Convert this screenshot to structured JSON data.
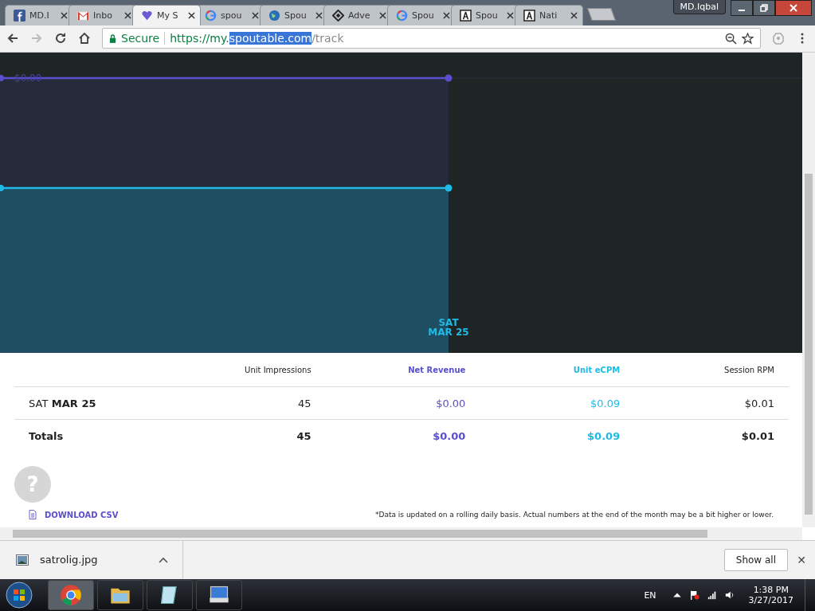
{
  "tabs": [
    {
      "title": "MD.I",
      "kind": "facebook",
      "selected": false
    },
    {
      "title": "Inbo",
      "kind": "gmail",
      "selected": false
    },
    {
      "title": "My S",
      "kind": "heart",
      "selected": true
    },
    {
      "title": "spou",
      "kind": "google",
      "selected": false
    },
    {
      "title": "Spou",
      "kind": "globe",
      "selected": false
    },
    {
      "title": "Adve",
      "kind": "diamond",
      "selected": false
    },
    {
      "title": "Spou",
      "kind": "google",
      "selected": false
    },
    {
      "title": "Spou",
      "kind": "letter",
      "selected": false
    },
    {
      "title": "Nati",
      "kind": "letter",
      "selected": false
    }
  ],
  "profile": "MD.Iqbal",
  "address": {
    "secure": "Secure",
    "prefix": "https://my.",
    "selected": "spoutable.com",
    "suffix": "/track"
  },
  "chart": {
    "line_label": "$0.00",
    "x_label_day": "SAT",
    "x_label_date": "MAR 25"
  },
  "table": {
    "columns": [
      {
        "label": "Unit Impressions",
        "kind": "plain"
      },
      {
        "label": "Net Revenue",
        "kind": "purple"
      },
      {
        "label": "Unit eCPM",
        "kind": "cyan"
      },
      {
        "label": "Session RPM",
        "kind": "plain"
      }
    ],
    "rows": [
      {
        "label_day": "SAT",
        "label_date": "MAR 25",
        "cells": [
          "45",
          "$0.00",
          "$0.09",
          "$0.01"
        ],
        "total": false
      },
      {
        "label_day": "Totals",
        "label_date": "",
        "cells": [
          "45",
          "$0.00",
          "$0.09",
          "$0.01"
        ],
        "total": true
      }
    ]
  },
  "help_button": "?",
  "download_csv": "DOWNLOAD CSV",
  "footnote": "*Data is updated on a rolling daily basis. Actual numbers at the end of the month may be a bit higher or lower.",
  "download_bar": {
    "file": "satrolig.jpg",
    "show_all": "Show all",
    "close": "✕"
  },
  "taskbar": {
    "language": "EN",
    "time": "1:38 PM",
    "date": "3/27/2017"
  }
}
